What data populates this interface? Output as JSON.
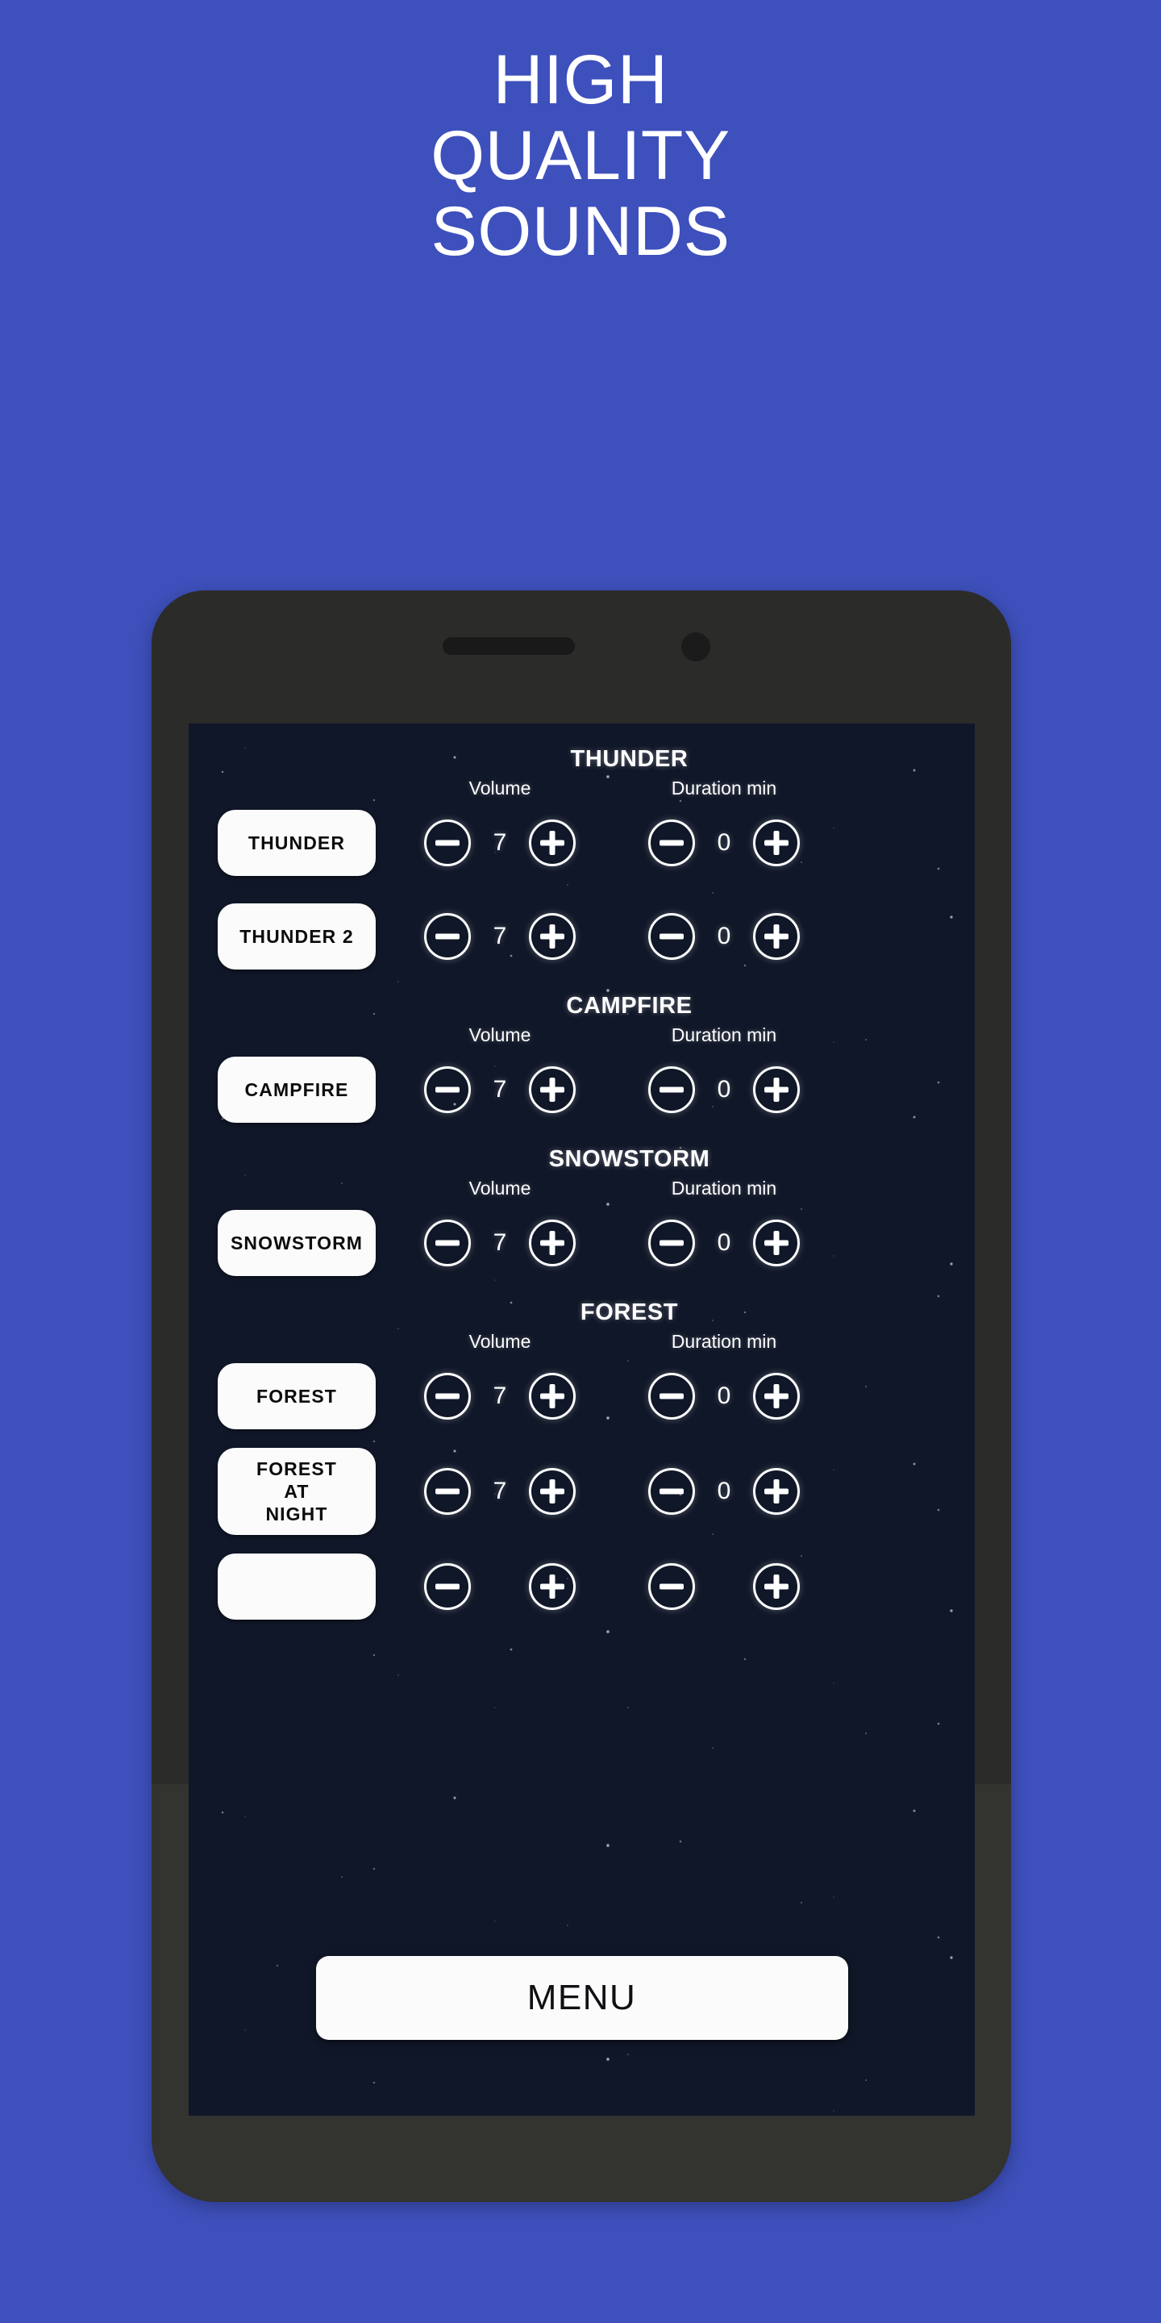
{
  "headline": {
    "lines": [
      "HIGH",
      "QUALITY",
      "SOUNDS"
    ]
  },
  "colors": {
    "background": "#3e50bc",
    "phone_body": "#2b2b29",
    "screen_background": "#101728",
    "button_face": "#fbfbfb",
    "button_text": "#0c0c0c",
    "screen_text": "#ffffff"
  },
  "phone": {
    "speaker_grill": "speaker-grill",
    "front_camera": "front-camera-icon"
  },
  "app": {
    "column_labels": {
      "volume": "Volume",
      "duration": "Duration min"
    },
    "stepper_icons": {
      "decrement": "minus-circle-icon",
      "increment": "plus-circle-icon"
    },
    "sections": [
      {
        "title": "THUNDER",
        "rows": [
          {
            "label": "THUNDER",
            "volume": "7",
            "duration": "0",
            "multiline": false
          },
          {
            "label": "THUNDER 2",
            "volume": "7",
            "duration": "0",
            "multiline": false
          }
        ]
      },
      {
        "title": "CAMPFIRE",
        "rows": [
          {
            "label": "CAMPFIRE",
            "volume": "7",
            "duration": "0",
            "multiline": false
          }
        ]
      },
      {
        "title": "SNOWSTORM",
        "rows": [
          {
            "label": "SNOWSTORM",
            "volume": "7",
            "duration": "0",
            "multiline": false
          }
        ]
      },
      {
        "title": "FOREST",
        "rows": [
          {
            "label": "FOREST",
            "volume": "7",
            "duration": "0",
            "multiline": false
          },
          {
            "label": "FOREST\nAT\nNIGHT",
            "volume": "7",
            "duration": "0",
            "multiline": true
          },
          {
            "label": "",
            "volume": "",
            "duration": "",
            "multiline": false,
            "clipped": true
          }
        ]
      }
    ],
    "menu_button_label": "MENU"
  }
}
